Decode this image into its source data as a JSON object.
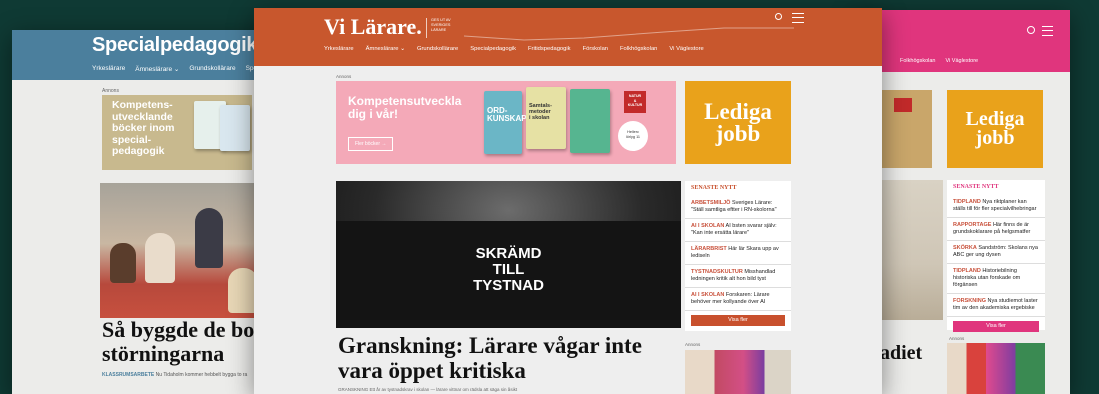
{
  "left": {
    "brand": "Specialpedagogik",
    "nav": [
      "Yrkeslärare",
      "Ämneslärare ⌄",
      "Grundskollärare",
      "Specia"
    ],
    "ad_label": "Annons",
    "ad_text": "Kompetens-\nutvecklande\nböcker inom\nspecial-\npedagogik",
    "headline": "Så byggde de bo\nstörningarna",
    "caption_tag": "KLASSRUMSARBETE",
    "caption_text": "Nu Tidaholm kommer hebbelt bygga to ra"
  },
  "center": {
    "brand": "Vi Lärare.",
    "brand_tag": "GES UT AV\nSVERIGES\nLÄRARE",
    "nav": [
      "Yrkeslärare",
      "Ämneslärare ⌄",
      "Grundskollärare",
      "Specialpedagogik",
      "Fritidspedagogik",
      "Förskolan",
      "Folkhögskolan",
      "Vi Väglestore"
    ],
    "ad_label": "Annons",
    "ad_text": "Kompetensutveckla\ndig i vår!",
    "ad_button": "Fler böcker →",
    "book_ord": "ORD-\nKUNSKAP",
    "book_samtal": "Samtals-\nmetoder\ni skolan",
    "publisher": "NATUR\n&\nKULTUR",
    "badge": "Hellerc\nlörlyg 11",
    "lediga": "Lediga\njobb",
    "hero_text": "SKRÄMD\nTILL\nTYSTNAD",
    "headline": "Granskning: Lärare vågar inte\nvara öppet kritiska",
    "caption": "GRANSKNING Ett år av tystnadskrav i skolan — lärare vittnar om rädsla att säga sin åsikt",
    "news_title": "SENASTE NYTT",
    "news": [
      {
        "tag": "ARBETSMILJÖ",
        "text": "Sveriges Lärare: \"Ställ samtliga eftter i RN-skolornа\""
      },
      {
        "tag": "AI I SKOLAN",
        "text": "AI bsten svarar själv: \"Kan inte ersätta lärare\""
      },
      {
        "tag": "LÄRARBRIST",
        "text": "Här lär Skara upp av lediseln"
      },
      {
        "tag": "TYSTNADSKULTUR",
        "text": "Misshandlad ledningen kritik alt hon bild tyst"
      },
      {
        "tag": "AI I SKOLAN",
        "text": "Forskaren: Lärare behöver mer kollyande över AI"
      }
    ],
    "news_button": "Visa fler",
    "ad_label2": "Annons"
  },
  "right": {
    "lediga": "Lediga\njobb",
    "nav": [
      "Folkhögskolan",
      "Vi Väglestore"
    ],
    "news_title": "SENASTE NYTT",
    "news": [
      {
        "tag": "TIDPLAND",
        "text": "Nya riktplaner kan ställs till för fler specialvilhebringar"
      },
      {
        "tag": "RAPPORTAGE",
        "text": "Här finns de är grundskoklarare på helgsmatfer"
      },
      {
        "tag": "SKÖRKA",
        "text": "Sandström: Skolans nya ABC ger ung dysen"
      },
      {
        "tag": "TIDPLAND",
        "text": "Historiebilning historiska utan forskade om förgänsen"
      },
      {
        "tag": "FORSKNING",
        "text": "Nya studiemot laster tim av den akademiska ergebiske"
      }
    ],
    "news_button": "Visa fler",
    "headline": "adiet",
    "ad_label": "Annons"
  },
  "colors": {
    "center_header": "#c8572d",
    "left_header": "#4b7f9d",
    "right_header": "#e0357d",
    "lediga": "#e9a21b",
    "ad_pink": "#f4a9b8",
    "news_button": "#c8502d",
    "right_button": "#e0357d"
  }
}
